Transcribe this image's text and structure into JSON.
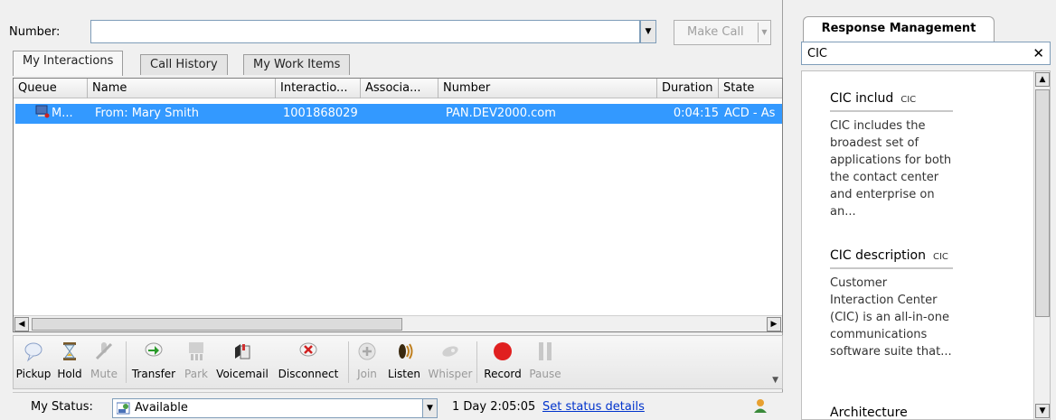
{
  "number_bar": {
    "label": "Number:",
    "value": "",
    "make_call_label": "Make Call"
  },
  "tabs": [
    {
      "label": "My Interactions",
      "active": true
    },
    {
      "label": "Call History",
      "active": false
    },
    {
      "label": "My Work Items",
      "active": false
    }
  ],
  "grid": {
    "columns": [
      "Queue",
      "Name",
      "Interactio...",
      "Associa...",
      "Number",
      "Duration",
      "State"
    ],
    "rows": [
      {
        "queue": "M...",
        "name": "From: Mary Smith",
        "interaction": "1001868029",
        "associated": "",
        "number": "PAN.DEV2000.com",
        "duration": "0:04:15",
        "state": "ACD - As",
        "selected": true
      }
    ]
  },
  "toolbar": [
    {
      "label": "Pickup",
      "icon": "pickup-icon",
      "enabled": true
    },
    {
      "label": "Hold",
      "icon": "hourglass-icon",
      "enabled": true
    },
    {
      "label": "Mute",
      "icon": "mic-muted-icon",
      "enabled": false
    },
    {
      "label": "Transfer",
      "icon": "transfer-arrow-icon",
      "enabled": true
    },
    {
      "label": "Park",
      "icon": "park-icon",
      "enabled": false
    },
    {
      "label": "Voicemail",
      "icon": "voicemail-icon",
      "enabled": true
    },
    {
      "label": "Disconnect",
      "icon": "disconnect-icon",
      "enabled": true
    },
    {
      "label": "Join",
      "icon": "join-icon",
      "enabled": false
    },
    {
      "label": "Listen",
      "icon": "listen-icon",
      "enabled": true
    },
    {
      "label": "Whisper",
      "icon": "whisper-icon",
      "enabled": false
    },
    {
      "label": "Record",
      "icon": "record-icon",
      "enabled": true
    },
    {
      "label": "Pause",
      "icon": "pause-icon",
      "enabled": false
    }
  ],
  "status_bar": {
    "label": "My Status:",
    "value": "Available",
    "duration": "1 Day 2:05:05",
    "details_link": "Set status details"
  },
  "response_management": {
    "title": "Response Management",
    "search_value": "CIC",
    "items": [
      {
        "title": "CIC includ",
        "tag": "CIC",
        "body": "CIC includes the broadest set of applications for both the contact center and enterprise on an..."
      },
      {
        "title": "CIC description",
        "tag": "CIC",
        "body": "Customer Interaction Center (CIC) is an all-in-one communications software suite that..."
      },
      {
        "title": "Architecture",
        "tag": "",
        "body": ""
      }
    ]
  },
  "colors": {
    "selection": "#3399ff",
    "link": "#0033cc",
    "record": "#e02020"
  }
}
